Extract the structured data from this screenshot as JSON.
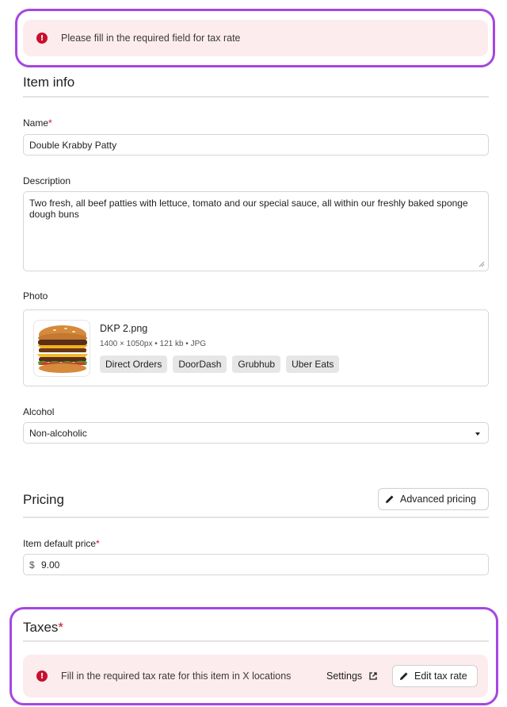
{
  "top_alert": {
    "message": "Please fill in the required field for tax rate",
    "icon": "error-icon"
  },
  "item_info": {
    "title": "Item info",
    "name": {
      "label": "Name",
      "required_marker": "*",
      "value": "Double Krabby Patty"
    },
    "description": {
      "label": "Description",
      "value": "Two fresh, all beef patties with lettuce, tomato and our special sauce, all within our freshly baked sponge dough buns"
    },
    "photo": {
      "label": "Photo",
      "file_name": "DKP 2.png",
      "meta": "1400 × 1050px • 121 kb • JPG",
      "channels": [
        "Direct Orders",
        "DoorDash",
        "Grubhub",
        "Uber Eats"
      ]
    },
    "alcohol": {
      "label": "Alcohol",
      "selected": "Non-alcoholic"
    }
  },
  "pricing": {
    "title": "Pricing",
    "advanced_button": "Advanced pricing",
    "default_price": {
      "label": "Item default price",
      "required_marker": "*",
      "currency": "$",
      "value": "9.00"
    }
  },
  "taxes": {
    "title": "Taxes",
    "required_marker": "*",
    "alert_message": "Fill in the required tax rate for this item in X locations",
    "settings_link": "Settings",
    "edit_button": "Edit tax rate"
  },
  "colors": {
    "highlight": "#a646e0",
    "alert_bg": "#fdeced",
    "error": "#c8102e"
  }
}
